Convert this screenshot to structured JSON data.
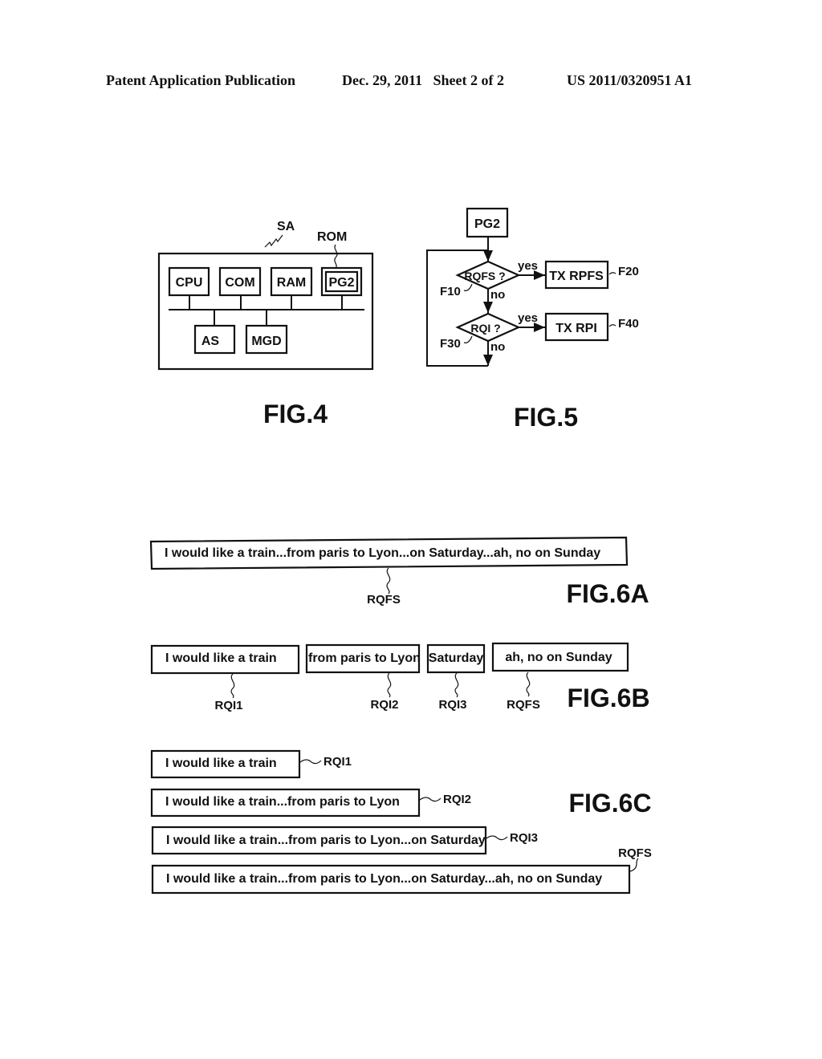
{
  "header": {
    "publication": "Patent Application Publication",
    "date_sheet": "Dec. 29, 2011   Sheet 2 of 2",
    "number": "US 2011/0320951 A1"
  },
  "fig4": {
    "caption": "FIG.4",
    "system_label": "SA",
    "rom_label": "ROM",
    "top_blocks": [
      "CPU",
      "COM",
      "RAM",
      "PG2"
    ],
    "bottom_blocks": [
      "AS",
      "MGD"
    ]
  },
  "fig5": {
    "caption": "FIG.5",
    "start": "PG2",
    "decision1": {
      "text": "RQFS ?",
      "ref": "F10",
      "yes": "yes",
      "no": "no"
    },
    "action1": {
      "text": "TX RPFS",
      "ref": "F20"
    },
    "decision2": {
      "text": "RQI ?",
      "ref": "F30",
      "yes": "yes",
      "no": "no"
    },
    "action2": {
      "text": "TX RPI",
      "ref": "F40"
    }
  },
  "fig6a": {
    "caption": "FIG.6A",
    "utterance": "I would like a train...from paris to Lyon...on Saturday...ah, no on Sunday",
    "label": "RQFS"
  },
  "fig6b": {
    "caption": "FIG.6B",
    "segments": [
      {
        "text": "I would like a train",
        "label": "RQI1"
      },
      {
        "text": "from paris to Lyon",
        "label": "RQI2"
      },
      {
        "text": "Saturday",
        "label": "RQI3"
      },
      {
        "text": "ah, no on Sunday",
        "label": "RQFS"
      }
    ]
  },
  "fig6c": {
    "caption": "FIG.6C",
    "rows": [
      {
        "text": "I would like a train",
        "label": "RQI1"
      },
      {
        "text": "I would like a train...from paris to Lyon",
        "label": "RQI2"
      },
      {
        "text": "I would like a train...from paris to Lyon...on Saturday",
        "label": "RQI3"
      },
      {
        "text": "I would like a train...from paris to Lyon...on Saturday...ah, no on Sunday",
        "label": "RQFS"
      }
    ]
  }
}
